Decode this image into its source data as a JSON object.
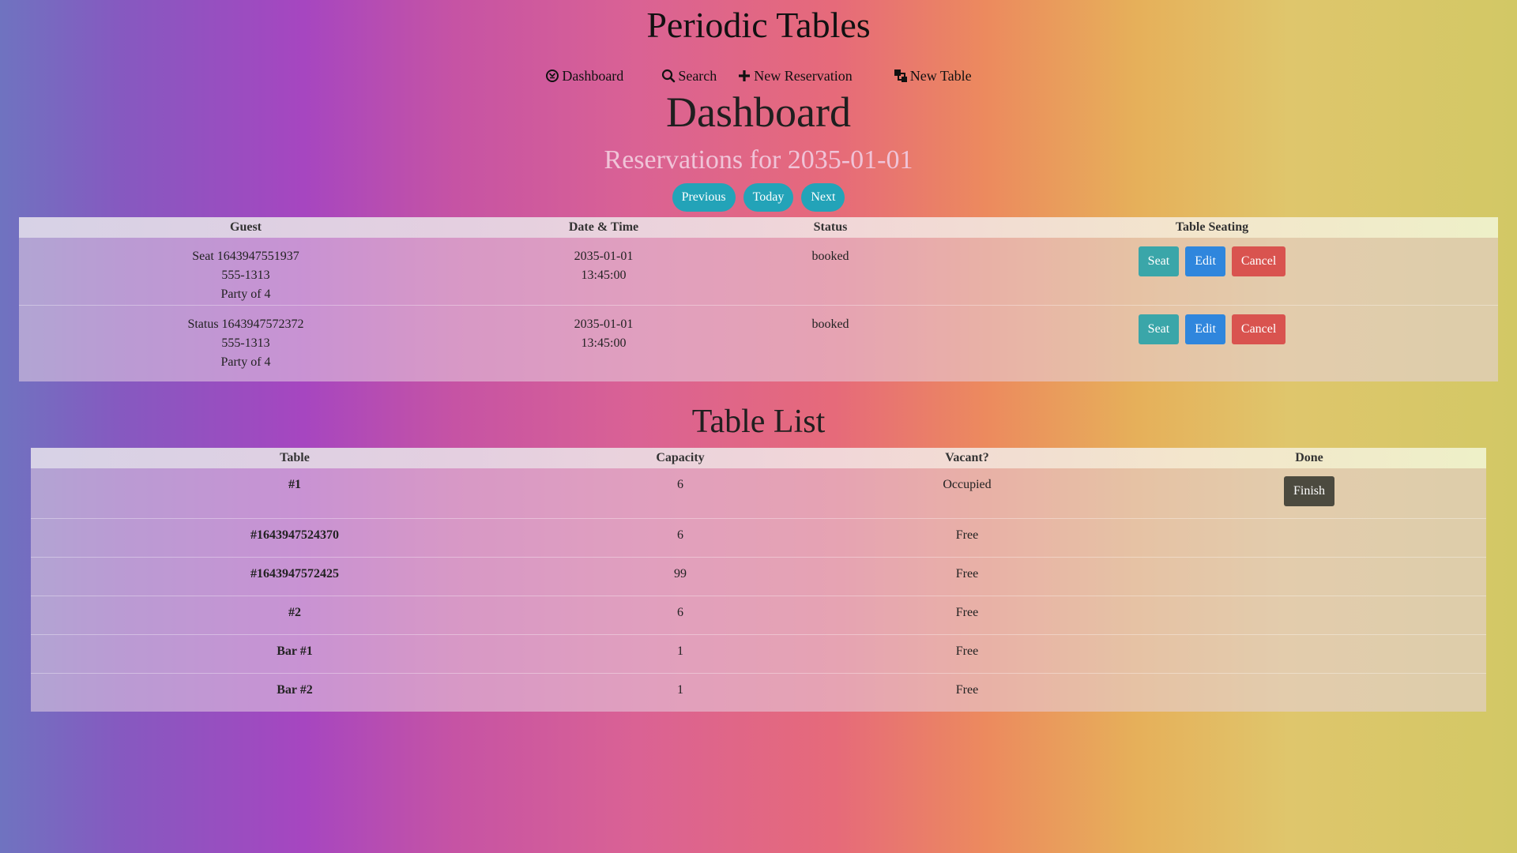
{
  "header": {
    "site_title": "Periodic Tables",
    "nav": [
      {
        "label": "Dashboard",
        "icon": "dashboard-icon"
      },
      {
        "label": "Search",
        "icon": "search-icon"
      },
      {
        "label": "New Reservation",
        "icon": "plus-icon"
      },
      {
        "label": "New Table",
        "icon": "layers-icon"
      }
    ]
  },
  "dashboard": {
    "title": "Dashboard",
    "subtitle": "Reservations for 2035-01-01",
    "date_nav": {
      "previous": "Previous",
      "today": "Today",
      "next": "Next"
    }
  },
  "reservations": {
    "columns": [
      "Guest",
      "Date & Time",
      "Status",
      "Table Seating"
    ],
    "rows": [
      {
        "name": "Seat 1643947551937",
        "phone": "555-1313",
        "party": "Party of 4",
        "date": "2035-01-01",
        "time": "13:45:00",
        "status": "booked",
        "seat_label": "Seat",
        "edit_label": "Edit",
        "cancel_label": "Cancel"
      },
      {
        "name": "Status 1643947572372",
        "phone": "555-1313",
        "party": "Party of 4",
        "date": "2035-01-01",
        "time": "13:45:00",
        "status": "booked",
        "seat_label": "Seat",
        "edit_label": "Edit",
        "cancel_label": "Cancel"
      }
    ]
  },
  "tables": {
    "title": "Table List",
    "columns": [
      "Table",
      "Capacity",
      "Vacant?",
      "Done"
    ],
    "rows": [
      {
        "name": "#1",
        "capacity": "6",
        "vacant": "Occupied",
        "finish_label": "Finish"
      },
      {
        "name": "#1643947524370",
        "capacity": "6",
        "vacant": "Free"
      },
      {
        "name": "#1643947572425",
        "capacity": "99",
        "vacant": "Free"
      },
      {
        "name": "#2",
        "capacity": "6",
        "vacant": "Free"
      },
      {
        "name": "Bar #1",
        "capacity": "1",
        "vacant": "Free"
      },
      {
        "name": "Bar #2",
        "capacity": "1",
        "vacant": "Free"
      }
    ]
  },
  "colors": {
    "pill_button": "#23a3b8",
    "seat_button": "#3aa6a9",
    "edit_button": "#2f86dd",
    "cancel_button": "#d9534f",
    "finish_button": "#4c4a3f"
  }
}
